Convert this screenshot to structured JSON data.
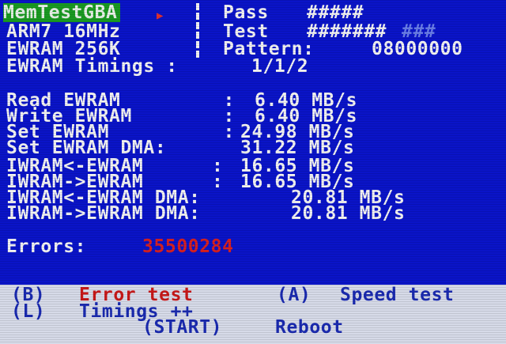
{
  "header": {
    "title": "MemTestGBA",
    "pass_label": "Pass",
    "pass_marks": "#####",
    "test_label": "Test",
    "test_marks_done": "#######",
    "test_marks_pending": "###",
    "cpu": "ARM7 16MHz",
    "ewram_size": "EWRAM 256K",
    "pattern_label": "Pattern:",
    "pattern_value": "08000000",
    "timings_label": "EWRAM Timings :",
    "timings_value": "1/1/2"
  },
  "speeds": [
    {
      "label": "Read EWRAM         :",
      "value": "6.40 MB/s"
    },
    {
      "label": "Write EWRAM        :",
      "value": "6.40 MB/s"
    },
    {
      "label": "Set EWRAM          :",
      "value": "24.98 MB/s"
    },
    {
      "label": "Set EWRAM DMA:",
      "value": "31.22 MB/s"
    },
    {
      "label": "IWRAM<-EWRAM      :",
      "value": "16.65 MB/s"
    },
    {
      "label": "IWRAM->EWRAM      :",
      "value": "16.65 MB/s"
    },
    {
      "label": "IWRAM<-EWRAM DMA:",
      "value": "20.81 MB/s"
    },
    {
      "label": "IWRAM->EWRAM DMA:",
      "value": "20.81 MB/s"
    }
  ],
  "errors": {
    "label": "Errors:",
    "count": "35500284"
  },
  "footer": {
    "b_key": "(B)",
    "b_action": "Error test",
    "a_key": "(A)",
    "a_action": "Speed test",
    "l_key": "(L)",
    "l_action": "Timings ++",
    "start_key": "(START)",
    "start_action": "Reboot"
  },
  "colors": {
    "screen_bg": "#0a14c8",
    "text": "#f2f2f2",
    "title_bg": "#1a9a22",
    "error_red": "#d82020",
    "footer_bg": "#d6dae8",
    "footer_text": "#1a2ab0"
  }
}
